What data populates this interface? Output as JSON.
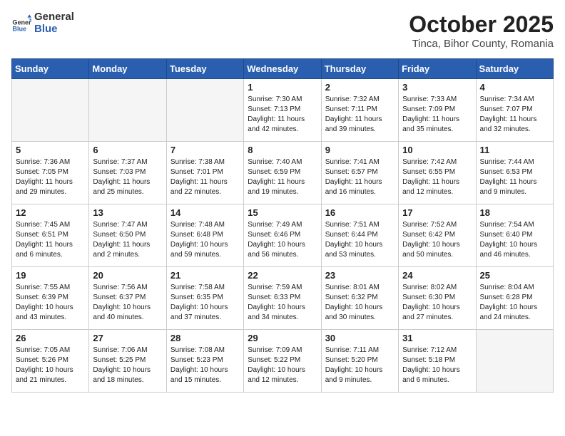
{
  "header": {
    "logo_general": "General",
    "logo_blue": "Blue",
    "month": "October 2025",
    "location": "Tinca, Bihor County, Romania"
  },
  "weekdays": [
    "Sunday",
    "Monday",
    "Tuesday",
    "Wednesday",
    "Thursday",
    "Friday",
    "Saturday"
  ],
  "weeks": [
    [
      {
        "day": "",
        "info": "",
        "empty": true
      },
      {
        "day": "",
        "info": "",
        "empty": true
      },
      {
        "day": "",
        "info": "",
        "empty": true
      },
      {
        "day": "1",
        "info": "Sunrise: 7:30 AM\nSunset: 7:13 PM\nDaylight: 11 hours\nand 42 minutes."
      },
      {
        "day": "2",
        "info": "Sunrise: 7:32 AM\nSunset: 7:11 PM\nDaylight: 11 hours\nand 39 minutes."
      },
      {
        "day": "3",
        "info": "Sunrise: 7:33 AM\nSunset: 7:09 PM\nDaylight: 11 hours\nand 35 minutes."
      },
      {
        "day": "4",
        "info": "Sunrise: 7:34 AM\nSunset: 7:07 PM\nDaylight: 11 hours\nand 32 minutes."
      }
    ],
    [
      {
        "day": "5",
        "info": "Sunrise: 7:36 AM\nSunset: 7:05 PM\nDaylight: 11 hours\nand 29 minutes."
      },
      {
        "day": "6",
        "info": "Sunrise: 7:37 AM\nSunset: 7:03 PM\nDaylight: 11 hours\nand 25 minutes."
      },
      {
        "day": "7",
        "info": "Sunrise: 7:38 AM\nSunset: 7:01 PM\nDaylight: 11 hours\nand 22 minutes."
      },
      {
        "day": "8",
        "info": "Sunrise: 7:40 AM\nSunset: 6:59 PM\nDaylight: 11 hours\nand 19 minutes."
      },
      {
        "day": "9",
        "info": "Sunrise: 7:41 AM\nSunset: 6:57 PM\nDaylight: 11 hours\nand 16 minutes."
      },
      {
        "day": "10",
        "info": "Sunrise: 7:42 AM\nSunset: 6:55 PM\nDaylight: 11 hours\nand 12 minutes."
      },
      {
        "day": "11",
        "info": "Sunrise: 7:44 AM\nSunset: 6:53 PM\nDaylight: 11 hours\nand 9 minutes."
      }
    ],
    [
      {
        "day": "12",
        "info": "Sunrise: 7:45 AM\nSunset: 6:51 PM\nDaylight: 11 hours\nand 6 minutes."
      },
      {
        "day": "13",
        "info": "Sunrise: 7:47 AM\nSunset: 6:50 PM\nDaylight: 11 hours\nand 2 minutes."
      },
      {
        "day": "14",
        "info": "Sunrise: 7:48 AM\nSunset: 6:48 PM\nDaylight: 10 hours\nand 59 minutes."
      },
      {
        "day": "15",
        "info": "Sunrise: 7:49 AM\nSunset: 6:46 PM\nDaylight: 10 hours\nand 56 minutes."
      },
      {
        "day": "16",
        "info": "Sunrise: 7:51 AM\nSunset: 6:44 PM\nDaylight: 10 hours\nand 53 minutes."
      },
      {
        "day": "17",
        "info": "Sunrise: 7:52 AM\nSunset: 6:42 PM\nDaylight: 10 hours\nand 50 minutes."
      },
      {
        "day": "18",
        "info": "Sunrise: 7:54 AM\nSunset: 6:40 PM\nDaylight: 10 hours\nand 46 minutes."
      }
    ],
    [
      {
        "day": "19",
        "info": "Sunrise: 7:55 AM\nSunset: 6:39 PM\nDaylight: 10 hours\nand 43 minutes."
      },
      {
        "day": "20",
        "info": "Sunrise: 7:56 AM\nSunset: 6:37 PM\nDaylight: 10 hours\nand 40 minutes."
      },
      {
        "day": "21",
        "info": "Sunrise: 7:58 AM\nSunset: 6:35 PM\nDaylight: 10 hours\nand 37 minutes."
      },
      {
        "day": "22",
        "info": "Sunrise: 7:59 AM\nSunset: 6:33 PM\nDaylight: 10 hours\nand 34 minutes."
      },
      {
        "day": "23",
        "info": "Sunrise: 8:01 AM\nSunset: 6:32 PM\nDaylight: 10 hours\nand 30 minutes."
      },
      {
        "day": "24",
        "info": "Sunrise: 8:02 AM\nSunset: 6:30 PM\nDaylight: 10 hours\nand 27 minutes."
      },
      {
        "day": "25",
        "info": "Sunrise: 8:04 AM\nSunset: 6:28 PM\nDaylight: 10 hours\nand 24 minutes."
      }
    ],
    [
      {
        "day": "26",
        "info": "Sunrise: 7:05 AM\nSunset: 5:26 PM\nDaylight: 10 hours\nand 21 minutes."
      },
      {
        "day": "27",
        "info": "Sunrise: 7:06 AM\nSunset: 5:25 PM\nDaylight: 10 hours\nand 18 minutes."
      },
      {
        "day": "28",
        "info": "Sunrise: 7:08 AM\nSunset: 5:23 PM\nDaylight: 10 hours\nand 15 minutes."
      },
      {
        "day": "29",
        "info": "Sunrise: 7:09 AM\nSunset: 5:22 PM\nDaylight: 10 hours\nand 12 minutes."
      },
      {
        "day": "30",
        "info": "Sunrise: 7:11 AM\nSunset: 5:20 PM\nDaylight: 10 hours\nand 9 minutes."
      },
      {
        "day": "31",
        "info": "Sunrise: 7:12 AM\nSunset: 5:18 PM\nDaylight: 10 hours\nand 6 minutes."
      },
      {
        "day": "",
        "info": "",
        "empty": true
      }
    ]
  ]
}
